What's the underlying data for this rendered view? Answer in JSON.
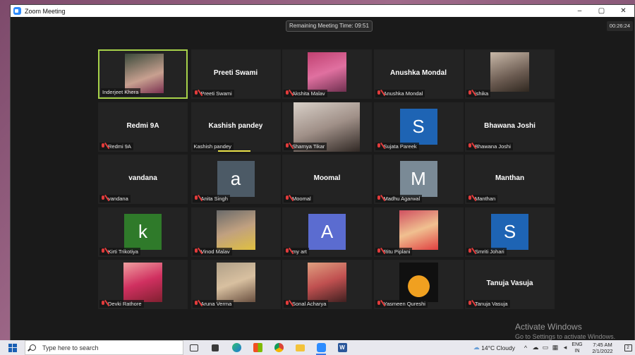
{
  "window": {
    "title": "Zoom Meeting",
    "controls": [
      "–",
      "▢",
      "✕"
    ]
  },
  "meeting": {
    "remaining_time": "Remaining Meeting Time: 09:51",
    "elapsed": "00:26:24"
  },
  "tiles": [
    {
      "name": "Inderjeet Khera",
      "display": "",
      "avatar_letter": "",
      "muted": false,
      "photo": true,
      "active": true
    },
    {
      "name": "Preeti Swami",
      "display": "Preeti Swami",
      "avatar_letter": "",
      "muted": true,
      "photo": false
    },
    {
      "name": "Akshita Malav",
      "display": "",
      "avatar_letter": "",
      "muted": true,
      "photo": true
    },
    {
      "name": "Anushka Mondal",
      "display": "Anushka Mondal",
      "avatar_letter": "",
      "muted": true,
      "photo": false
    },
    {
      "name": "ishika",
      "display": "",
      "avatar_letter": "",
      "muted": true,
      "photo": true
    },
    {
      "name": "Redmi 9A",
      "display": "Redmi 9A",
      "avatar_letter": "",
      "muted": true,
      "photo": false
    },
    {
      "name": "Kashish pandey",
      "display": "Kashish pandey",
      "avatar_letter": "",
      "muted": false,
      "photo": false,
      "speaking": true
    },
    {
      "name": "Sharnya Tikar",
      "display": "",
      "avatar_letter": "",
      "muted": true,
      "photo": true
    },
    {
      "name": "Sujata Pareek",
      "display": "",
      "avatar_letter": "S",
      "muted": true,
      "photo": false
    },
    {
      "name": "Bhawana Joshi",
      "display": "Bhawana Joshi",
      "avatar_letter": "",
      "muted": true,
      "photo": false
    },
    {
      "name": "vandana",
      "display": "vandana",
      "avatar_letter": "",
      "muted": true,
      "photo": false
    },
    {
      "name": "Anita Singh",
      "display": "",
      "avatar_letter": "a",
      "muted": true,
      "photo": false
    },
    {
      "name": "Moomal",
      "display": "Moomal",
      "avatar_letter": "",
      "muted": true,
      "photo": false
    },
    {
      "name": "Madhu Agarwal",
      "display": "",
      "avatar_letter": "M",
      "muted": true,
      "photo": false
    },
    {
      "name": "Manthan",
      "display": "Manthan",
      "avatar_letter": "",
      "muted": true,
      "photo": false
    },
    {
      "name": "Kirti Trikotiya",
      "display": "",
      "avatar_letter": "k",
      "muted": true,
      "photo": false
    },
    {
      "name": "Vinod Malav",
      "display": "",
      "avatar_letter": "",
      "muted": true,
      "photo": true
    },
    {
      "name": "my art",
      "display": "",
      "avatar_letter": "A",
      "muted": true,
      "photo": false
    },
    {
      "name": "Ritu Piplani",
      "display": "",
      "avatar_letter": "",
      "muted": true,
      "photo": true
    },
    {
      "name": "Smriti Johari",
      "display": "",
      "avatar_letter": "S",
      "muted": true,
      "photo": false
    },
    {
      "name": "Devki Rathore",
      "display": "",
      "avatar_letter": "",
      "muted": true,
      "photo": true
    },
    {
      "name": "Aruna Verma",
      "display": "",
      "avatar_letter": "",
      "muted": true,
      "photo": true
    },
    {
      "name": "Sonal Acharya",
      "display": "",
      "avatar_letter": "",
      "muted": true,
      "photo": true
    },
    {
      "name": "Yasmeen Qureshi",
      "display": "",
      "avatar_letter": "",
      "muted": true,
      "photo": true
    },
    {
      "name": "Tanuja Vasuja",
      "display": "Tanuja Vasuja",
      "avatar_letter": "",
      "muted": true,
      "photo": false
    }
  ],
  "colors": {
    "active_border": "#a7d24a",
    "muted_icon": "#e23b3b",
    "avatar_blue": "#1e64b4",
    "avatar_slate": "#4c5a66",
    "avatar_grey": "#7a8a96",
    "avatar_green": "#2f7a2a",
    "avatar_indigo": "#5b6cd0"
  },
  "watermark": {
    "line1": "Activate Windows",
    "line2": "Go to Settings to activate Windows."
  },
  "taskbar": {
    "search_placeholder": "Type here to search",
    "weather": "14°C  Cloudy",
    "lang_line1": "ENG",
    "lang_line2": "IN",
    "time": "7:45 AM",
    "date": "2/1/2022",
    "notifications": "2",
    "apps": [
      "task-view-icon",
      "widgets-icon",
      "edge-icon",
      "store-icon",
      "chrome-icon",
      "file-explorer-icon",
      "zoom-icon",
      "word-icon"
    ]
  }
}
